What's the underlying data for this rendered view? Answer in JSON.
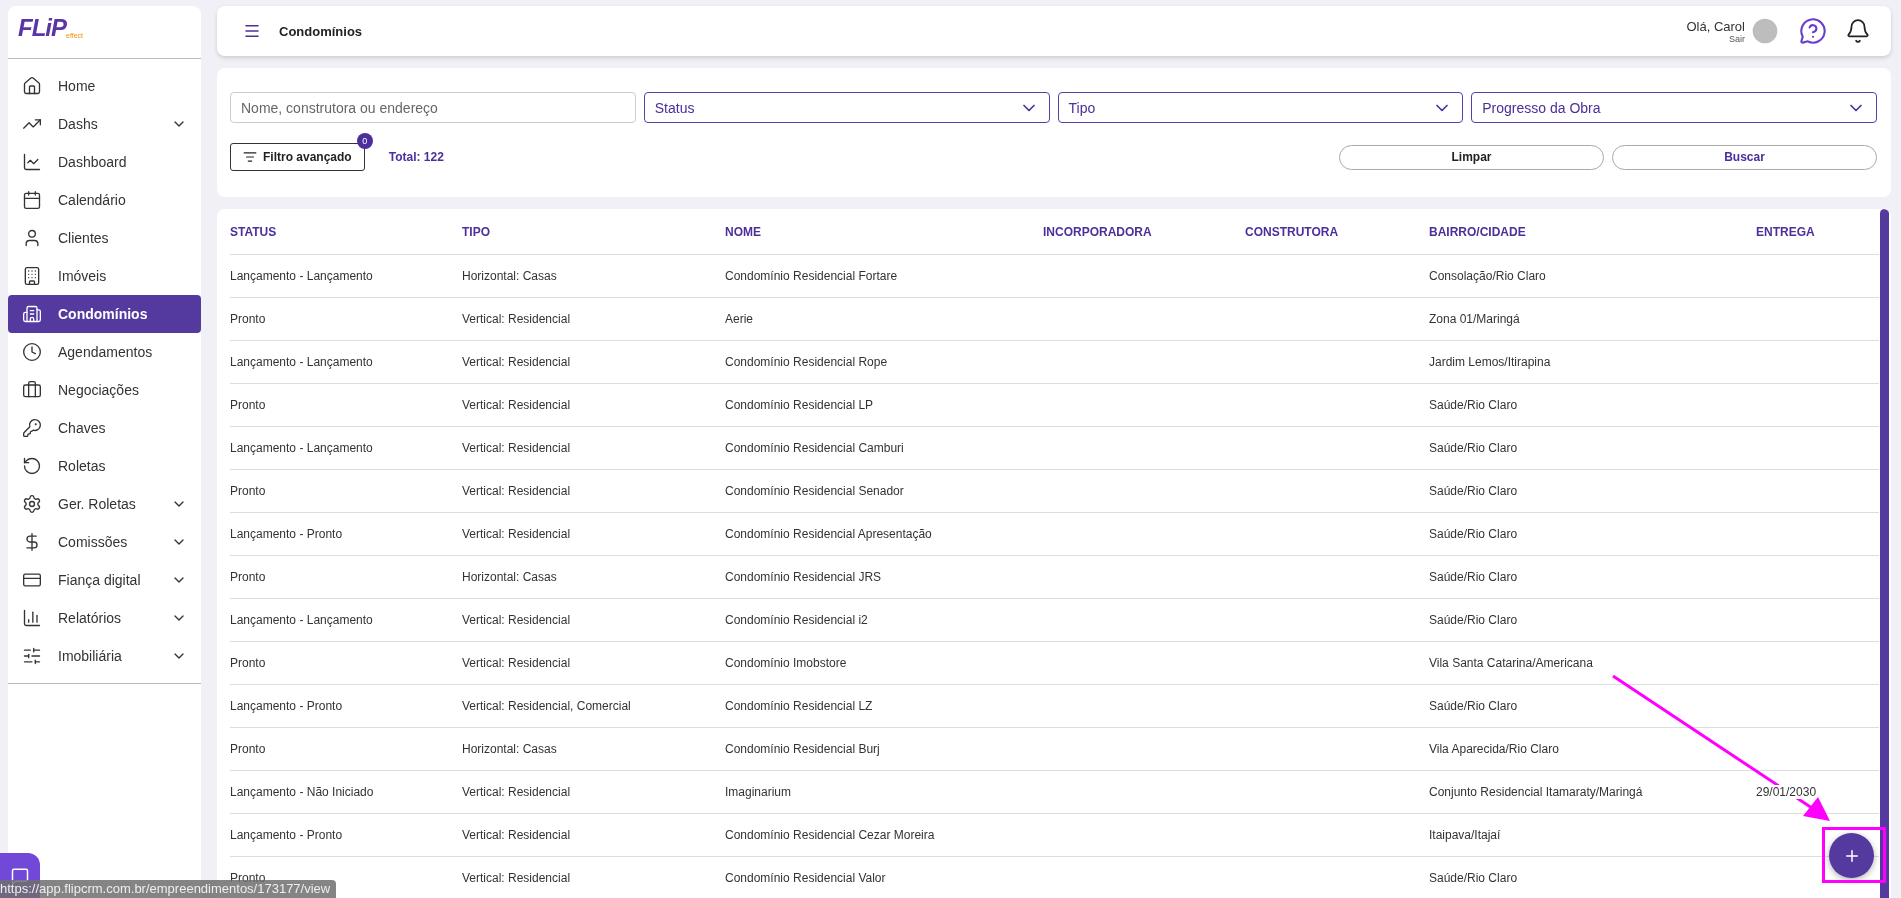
{
  "sidebar": {
    "logo": {
      "main": "FLiP",
      "sub": "effect"
    },
    "items": [
      {
        "label": "Home",
        "expandable": false,
        "selected": false
      },
      {
        "label": "Dashs",
        "expandable": true,
        "selected": false
      },
      {
        "label": "Dashboard",
        "expandable": false,
        "selected": false
      },
      {
        "label": "Calendário",
        "expandable": false,
        "selected": false
      },
      {
        "label": "Clientes",
        "expandable": false,
        "selected": false
      },
      {
        "label": "Imóveis",
        "expandable": false,
        "selected": false
      },
      {
        "label": "Condomínios",
        "expandable": false,
        "selected": true
      },
      {
        "label": "Agendamentos",
        "expandable": false,
        "selected": false
      },
      {
        "label": "Negociações",
        "expandable": false,
        "selected": false
      },
      {
        "label": "Chaves",
        "expandable": false,
        "selected": false
      },
      {
        "label": "Roletas",
        "expandable": false,
        "selected": false
      },
      {
        "label": "Ger. Roletas",
        "expandable": true,
        "selected": false
      },
      {
        "label": "Comissões",
        "expandable": true,
        "selected": false
      },
      {
        "label": "Fiança digital",
        "expandable": true,
        "selected": false
      },
      {
        "label": "Relatórios",
        "expandable": true,
        "selected": false
      },
      {
        "label": "Imobiliária",
        "expandable": true,
        "selected": false
      }
    ]
  },
  "header": {
    "title": "Condomínios",
    "greeting": "Olá, Carol",
    "logout": "Sair"
  },
  "filters": {
    "search": {
      "placeholder": "Nome, construtora ou endereço"
    },
    "selects": [
      "Status",
      "Tipo",
      "Progresso da Obra"
    ],
    "advanced": {
      "label": "Filtro avançado",
      "count": "0"
    },
    "total": "Total: 122",
    "buttons": [
      "Limpar",
      "Buscar"
    ]
  },
  "table": {
    "columns": [
      "STATUS",
      "TIPO",
      "NOME",
      "INCORPORADORA",
      "CONSTRUTORA",
      "BAIRRO/CIDADE",
      "ENTREGA"
    ],
    "rows": [
      [
        "Lançamento - Lançamento",
        "Horizontal: Casas",
        "Condomínio Residencial Fortare",
        "",
        "",
        "Consolação/Rio Claro",
        ""
      ],
      [
        "Pronto",
        "Vertical: Residencial",
        "Aerie",
        "",
        "",
        "Zona 01/Maringá",
        ""
      ],
      [
        "Lançamento - Lançamento",
        "Vertical: Residencial",
        "Condomínio Residencial Rope",
        "",
        "",
        "Jardim Lemos/Itirapina",
        ""
      ],
      [
        "Pronto",
        "Vertical: Residencial",
        "Condomínio Residencial LP",
        "",
        "",
        "Saúde/Rio Claro",
        ""
      ],
      [
        "Lançamento - Lançamento",
        "Vertical: Residencial",
        "Condomínio Residencial Camburi",
        "",
        "",
        "Saúde/Rio Claro",
        ""
      ],
      [
        "Pronto",
        "Vertical: Residencial",
        "Condomínio Residencial Senador",
        "",
        "",
        "Saúde/Rio Claro",
        ""
      ],
      [
        "Lançamento - Pronto",
        "Vertical: Residencial",
        "Condomínio Residencial Apresentação",
        "",
        "",
        "Saúde/Rio Claro",
        ""
      ],
      [
        "Pronto",
        "Horizontal: Casas",
        "Condomínio Residencial JRS",
        "",
        "",
        "Saúde/Rio Claro",
        ""
      ],
      [
        "Lançamento - Lançamento",
        "Vertical: Residencial",
        "Condomínio Residencial i2",
        "",
        "",
        "Saúde/Rio Claro",
        ""
      ],
      [
        "Pronto",
        "Vertical: Residencial",
        "Condomínio Imobstore",
        "",
        "",
        "Vila Santa Catarina/Americana",
        ""
      ],
      [
        "Lançamento - Pronto",
        "Vertical: Residencial, Comercial",
        "Condomínio Residencial LZ",
        "",
        "",
        "Saúde/Rio Claro",
        ""
      ],
      [
        "Pronto",
        "Horizontal: Casas",
        "Condomínio Residencial Burj",
        "",
        "",
        "Vila Aparecida/Rio Claro",
        ""
      ],
      [
        "Lançamento - Não Iniciado",
        "Vertical: Residencial",
        "Imaginarium",
        "",
        "",
        "Conjunto Residencial Itamaraty/Maringá",
        "29/01/2030"
      ],
      [
        "Lançamento - Pronto",
        "Vertical: Residencial",
        "Condomínio Residencial Cezar Moreira",
        "",
        "",
        "Itaipava/Itajaí",
        ""
      ],
      [
        "Pronto",
        "Vertical: Residencial",
        "Condomínio Residencial Valor",
        "",
        "",
        "Saúde/Rio Claro",
        ""
      ]
    ]
  },
  "status_url": "https://app.flipcrm.com.br/empreendimentos/173177/view"
}
